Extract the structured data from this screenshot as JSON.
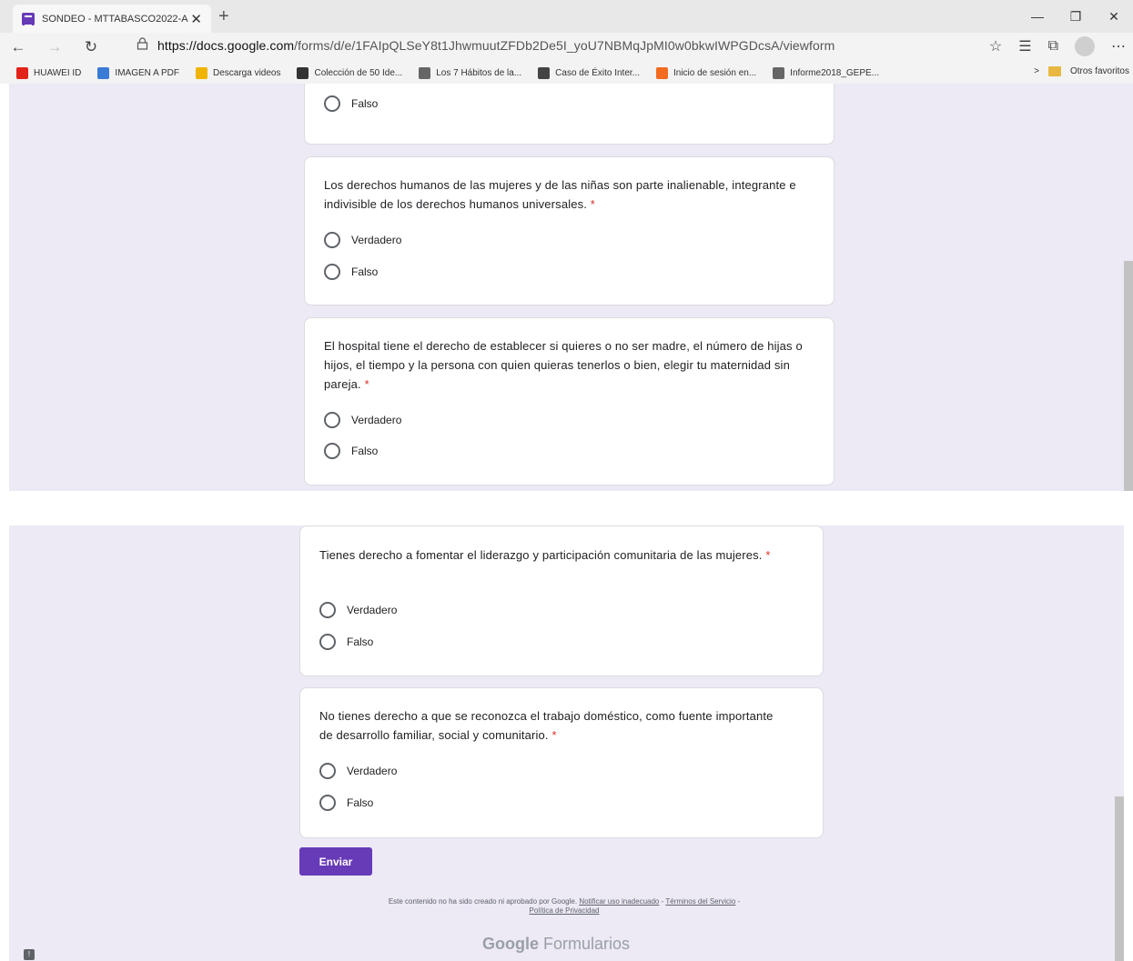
{
  "browser": {
    "tab_title": "SONDEO - MTTABASCO2022-A",
    "tab_close": "✕",
    "new_tab": "+",
    "window": {
      "minimize": "—",
      "restore": "❐",
      "close": "✕"
    },
    "nav": {
      "back": "←",
      "forward": "→",
      "refresh": "↻",
      "lock": "🔒"
    },
    "url_host": "https://docs.google.com",
    "url_path": "/forms/d/e/1FAIpQLSeY8t1JhwmuutZFDb2De5I_yoU7NBMqJpMI0w0bkwIWPGDcsA/viewform",
    "bookmarks": [
      {
        "label": "HUAWEI ID",
        "color": "#e2231a"
      },
      {
        "label": "IMAGEN A PDF",
        "color": "#3a7bd5"
      },
      {
        "label": "Descarga videos",
        "color": "#f0b400"
      },
      {
        "label": "Colección de 50 Ide...",
        "color": "#333333"
      },
      {
        "label": "Los 7 Hábitos de la...",
        "color": "#666666"
      },
      {
        "label": "Caso de Éxito Inter...",
        "color": "#444444"
      },
      {
        "label": "Inicio de sesión en...",
        "color": "#f26b21"
      },
      {
        "label": "Informe2018_GEPE...",
        "color": "#666666"
      }
    ],
    "bookmarks_more": ">",
    "other_favorites": "Otros favoritos"
  },
  "form_top": {
    "partial_option": "Falso",
    "questions": [
      {
        "text": "Los derechos humanos de las mujeres y de las niñas son parte inalienable, integrante e indivisible de los derechos humanos universales.",
        "required": "*",
        "options": [
          "Verdadero",
          "Falso"
        ]
      },
      {
        "text": "El hospital tiene el derecho de establecer si quieres o no ser madre, el número de hijas o hijos, el tiempo y la persona con quien quieras tenerlos o bien, elegir tu maternidad sin pareja.",
        "required": "*",
        "options": [
          "Verdadero",
          "Falso"
        ]
      }
    ]
  },
  "form_bottom": {
    "questions": [
      {
        "text": "Tienes derecho a fomentar el liderazgo y participación comunitaria de las mujeres.",
        "required": "*",
        "options": [
          "Verdadero",
          "Falso"
        ]
      },
      {
        "text": "No tienes derecho a que se reconozca el trabajo doméstico, como fuente importante de desarrollo familiar, social y comunitario.",
        "required": "*",
        "options": [
          "Verdadero",
          "Falso"
        ]
      }
    ],
    "submit_label": "Enviar",
    "footer_text": "Este contenido no ha sido creado ni aprobado por Google.",
    "footer_link_report": "Notificar uso inadecuado",
    "footer_sep": "-",
    "footer_link_terms": "Términos del Servicio",
    "footer_link_privacy": "Política de Privacidad",
    "brand_google": "Google",
    "brand_product": "Formularios",
    "report_icon": "!"
  }
}
